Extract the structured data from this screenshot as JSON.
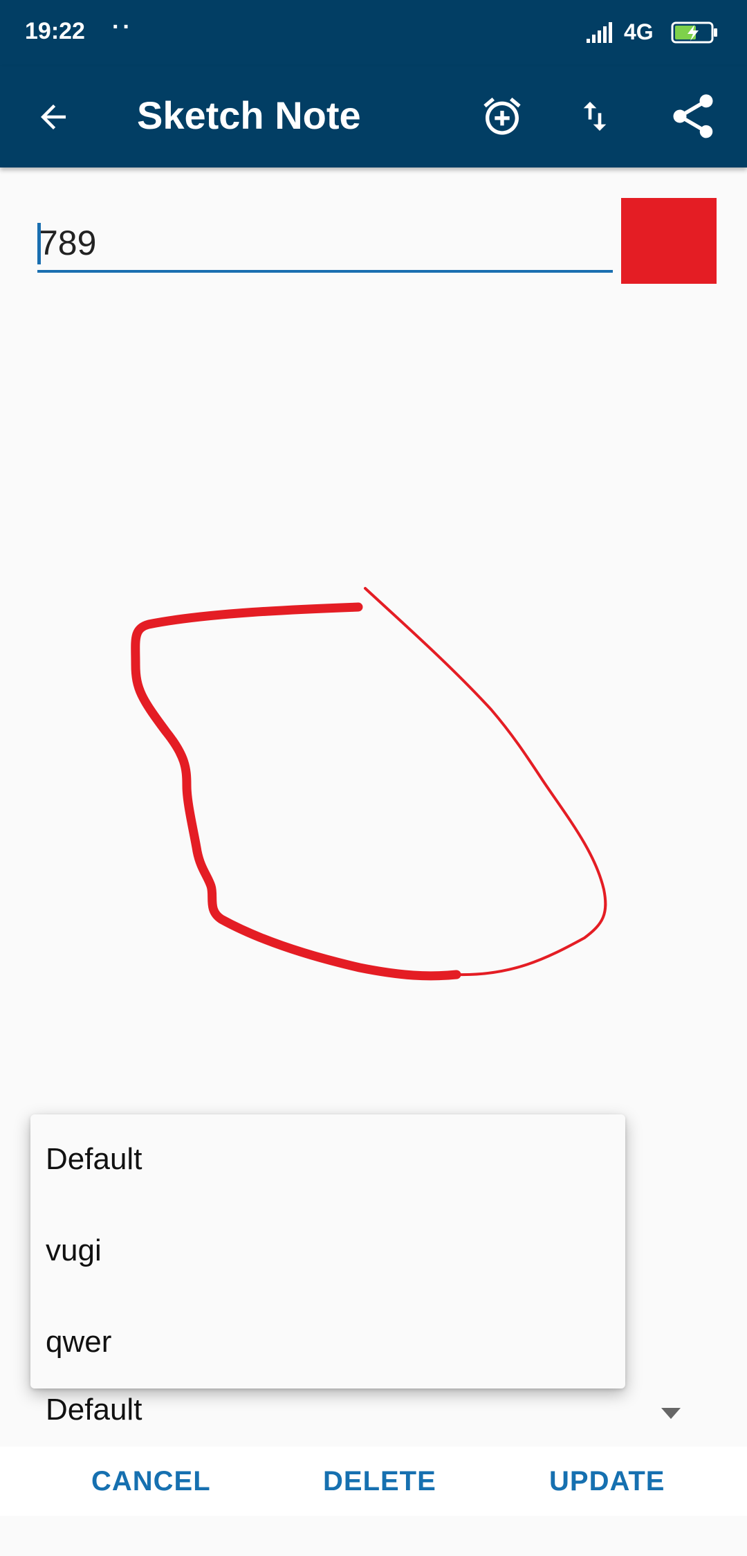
{
  "status": {
    "time": "19:22",
    "dots": "··",
    "network": "4G"
  },
  "toolbar": {
    "title": "Sketch Note",
    "icons": [
      "back-arrow-icon",
      "alarm-add-icon",
      "sort-icon",
      "share-icon"
    ]
  },
  "note": {
    "title_value": "789",
    "color": "#e41d24"
  },
  "category_dropdown": {
    "options": [
      "Default",
      "vugi",
      "qwer"
    ]
  },
  "category_spinner": {
    "selected": "Default"
  },
  "actions": {
    "cancel": "CANCEL",
    "delete": "DELETE",
    "update": "UPDATE"
  },
  "colors": {
    "appbar": "#023e64",
    "accent": "#1670b0",
    "sketch": "#e41d24"
  }
}
